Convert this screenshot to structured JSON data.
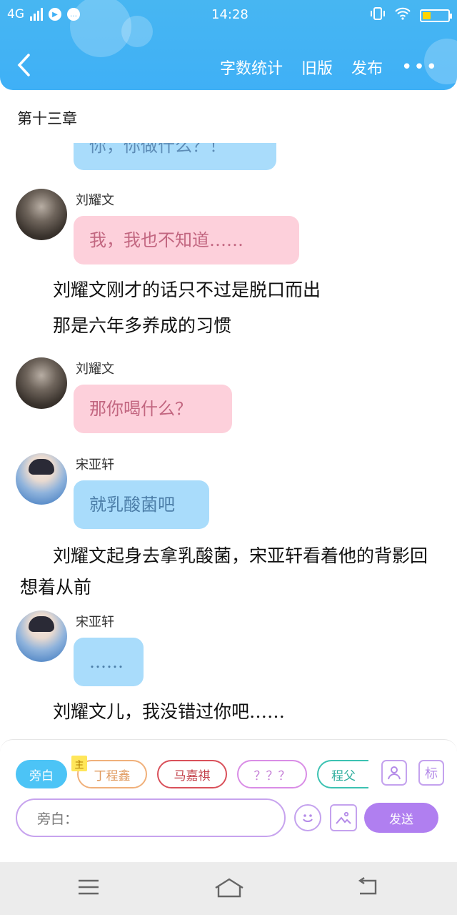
{
  "status_bar": {
    "network": "4G",
    "time": "14:28"
  },
  "nav": {
    "back_icon": "chevron-left-icon",
    "actions": [
      "字数统计",
      "旧版",
      "发布"
    ],
    "more_icon": "more-dots-icon"
  },
  "chapter_title": "第十三章",
  "chat": [
    {
      "kind": "partial_bubble",
      "color": "blue",
      "text": "你，你做什么？！"
    },
    {
      "kind": "msg",
      "name": "刘耀文",
      "avatar": "dark",
      "color": "pink",
      "text": "我，我也不知道……"
    },
    {
      "kind": "narr",
      "text": "刘耀文刚才的话只不过是脱口而出"
    },
    {
      "kind": "narr",
      "text": "那是六年多养成的习惯"
    },
    {
      "kind": "msg",
      "name": "刘耀文",
      "avatar": "dark",
      "color": "pink",
      "text": "那你喝什么？"
    },
    {
      "kind": "msg",
      "name": "宋亚轩",
      "avatar": "light",
      "color": "blue",
      "text": "就乳酸菌吧"
    },
    {
      "kind": "narr",
      "text": "刘耀文起身去拿乳酸菌，宋亚轩看着他的背影回想着从前"
    },
    {
      "kind": "msg",
      "name": "宋亚轩",
      "avatar": "light",
      "color": "blue",
      "text": "……"
    },
    {
      "kind": "narr",
      "text": "刘耀文儿，我没错过你吧……"
    }
  ],
  "roles": [
    {
      "label": "旁白",
      "active": true,
      "color": "#4cc4f6"
    },
    {
      "label": "丁程鑫",
      "tag": "主",
      "color": "#f0b07a"
    },
    {
      "label": "马嘉祺",
      "color": "#d9505a"
    },
    {
      "label": "？？？",
      "color": "#d98de6"
    },
    {
      "label": "程父",
      "color": "#3cc2b2"
    }
  ],
  "tools": {
    "person_icon": "person-icon",
    "tag_label": "标"
  },
  "input": {
    "placeholder": "旁白：",
    "emoji_icon": "smiley-icon",
    "image_icon": "image-icon",
    "send_label": "发送"
  },
  "colors": {
    "header": "#3fb0f6",
    "pink_bubble": "#fdd0db",
    "blue_bubble": "#a9dcfb",
    "accent_purple": "#b07ff0"
  }
}
